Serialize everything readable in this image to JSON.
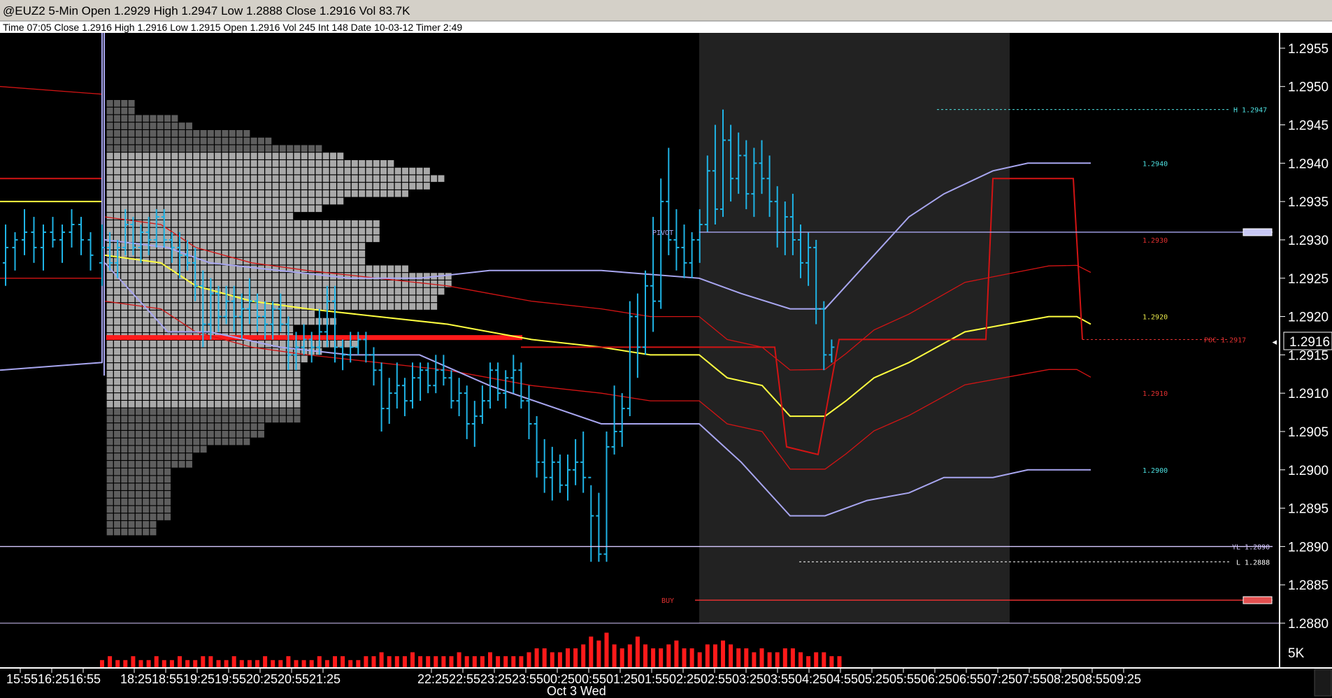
{
  "header": {
    "title": "@EUZ2 5-Min Open 1.2929 High 1.2947 Low 1.2888 Close 1.2916 Vol 83.7K",
    "info": "Time 07:05  Close 1.2916  High 1.2916  Low 1.2915  Open 1.2916  Vol 245  Int 148  Date 10-03-12  Timer 2:49"
  },
  "colors": {
    "background": "#000000",
    "price_bars": "#1fb4e6",
    "vwap": "#ffff40",
    "band_red": "#d21414",
    "band_lavender": "#a8a6f0",
    "profile_light": "#a9a9a9",
    "profile_dark": "#5e5e5e",
    "poc": "#ff1a1a",
    "session_shade": "#222222",
    "volume": "#ff1a1a"
  },
  "chart_data": {
    "type": "candlestick",
    "symbol": "@EUZ2",
    "interval": "5-Min",
    "ylim": [
      1.288,
      1.2957
    ],
    "y_ticks": [
      "1.2955",
      "1.2950",
      "1.2945",
      "1.2940",
      "1.2935",
      "1.2930",
      "1.2925",
      "1.2920",
      "1.2915",
      "1.2910",
      "1.2905",
      "1.2900",
      "1.2895",
      "1.2890",
      "1.2885",
      "1.2880"
    ],
    "last_price": "1.2916",
    "x_ticks": [
      "15:55",
      "16:25",
      "16:55",
      "18:25",
      "18:55",
      "19:25",
      "19:55",
      "20:25",
      "20:55",
      "21:25",
      "22:25",
      "22:55",
      "23:25",
      "23:55",
      "00:25",
      "00:55",
      "01:25",
      "01:55",
      "02:25",
      "02:55",
      "03:25",
      "03:55",
      "04:25",
      "04:55",
      "05:25",
      "05:55",
      "06:25",
      "06:55",
      "07:25",
      "07:55",
      "08:25",
      "08:55",
      "09:25"
    ],
    "date_label": "Oct 3 Wed",
    "volume_axis_label": "5K",
    "levels": [
      {
        "label": "H 1.2947",
        "value": 1.2947,
        "color": "#4de0e0",
        "style": "dashed"
      },
      {
        "label": "1.2940",
        "value": 1.294,
        "color": "#4de0e0",
        "style": "none"
      },
      {
        "label": "PIVOT",
        "value": 1.2931,
        "color": "#a8a6f0",
        "style": "solid"
      },
      {
        "label": "1.2930",
        "value": 1.293,
        "color": "#e23030",
        "style": "none"
      },
      {
        "label": "1.2920",
        "value": 1.292,
        "color": "#e8e84a",
        "style": "none"
      },
      {
        "label": "POC 1.2917",
        "value": 1.2917,
        "color": "#e23030",
        "style": "dashed"
      },
      {
        "label": "1.2910",
        "value": 1.291,
        "color": "#e23030",
        "style": "none"
      },
      {
        "label": "1.2900",
        "value": 1.29,
        "color": "#4de0e0",
        "style": "none"
      },
      {
        "label": "YL 1.2890",
        "value": 1.289,
        "color": "#d6c8ff",
        "style": "solid"
      },
      {
        "label": "L 1.2888",
        "value": 1.2888,
        "color": "#ffffff",
        "style": "dashed"
      },
      {
        "label": "BUY",
        "value": 1.2883,
        "color": "#e23030",
        "style": "solid"
      }
    ],
    "bars": [
      [
        1.2927,
        1.2932,
        1.2924,
        1.2929
      ],
      [
        1.2929,
        1.2931,
        1.2926,
        1.2927
      ],
      [
        1.2927,
        1.293,
        1.2925,
        1.2929
      ],
      [
        1.2929,
        1.2934,
        1.2928,
        1.2932
      ],
      [
        1.2932,
        1.2933,
        1.2928,
        1.2929
      ],
      [
        1.2929,
        1.2932,
        1.2927,
        1.2931
      ],
      [
        1.2931,
        1.2933,
        1.2928,
        1.293
      ],
      [
        1.293,
        1.2934,
        1.2929,
        1.2933
      ],
      [
        1.2933,
        1.2934,
        1.2929,
        1.293
      ],
      [
        1.293,
        1.2931,
        1.2927,
        1.2929
      ],
      [
        1.2929,
        1.2931,
        1.2925,
        1.2928
      ],
      [
        1.2928,
        1.293,
        1.2926,
        1.2927
      ],
      [
        1.2927,
        1.2929,
        1.2922,
        1.2924
      ],
      [
        1.2924,
        1.2926,
        1.2916,
        1.2919
      ],
      [
        1.2919,
        1.2925,
        1.2917,
        1.2923
      ],
      [
        1.2923,
        1.2924,
        1.2918,
        1.292
      ],
      [
        1.292,
        1.2924,
        1.2919,
        1.2922
      ],
      [
        1.2922,
        1.2924,
        1.2918,
        1.292
      ],
      [
        1.292,
        1.2923,
        1.2917,
        1.2921
      ],
      [
        1.2921,
        1.2925,
        1.2919,
        1.2922
      ],
      [
        1.2922,
        1.2923,
        1.2918,
        1.292
      ],
      [
        1.292,
        1.2922,
        1.2917,
        1.2919
      ],
      [
        1.2919,
        1.2922,
        1.2917,
        1.2921
      ],
      [
        1.2921,
        1.2923,
        1.2918,
        1.2919
      ],
      [
        1.2919,
        1.292,
        1.2913,
        1.2915
      ],
      [
        1.2915,
        1.2918,
        1.2913,
        1.2916
      ],
      [
        1.2916,
        1.2919,
        1.2915,
        1.2917
      ],
      [
        1.2917,
        1.2918,
        1.2914,
        1.2916
      ],
      [
        1.2916,
        1.2921,
        1.2915,
        1.2918
      ],
      [
        1.2918,
        1.2924,
        1.2916,
        1.2922
      ],
      [
        1.2922,
        1.2924,
        1.2914,
        1.2916
      ],
      [
        1.2916,
        1.2917,
        1.2913,
        1.2915
      ],
      [
        1.2915,
        1.2918,
        1.2914,
        1.2916
      ],
      [
        1.2916,
        1.2918,
        1.2915,
        1.2917
      ],
      [
        1.2917,
        1.2918,
        1.2914,
        1.2915
      ],
      [
        1.2915,
        1.2916,
        1.2911,
        1.2913
      ],
      [
        1.2913,
        1.2914,
        1.2905,
        1.2908
      ],
      [
        1.2908,
        1.2912,
        1.2906,
        1.291
      ],
      [
        1.291,
        1.2914,
        1.2908,
        1.2911
      ],
      [
        1.2911,
        1.2912,
        1.2907,
        1.2909
      ],
      [
        1.2909,
        1.2914,
        1.2908,
        1.2912
      ],
      [
        1.2912,
        1.2914,
        1.2909,
        1.2913
      ],
      [
        1.2913,
        1.2914,
        1.291,
        1.2911
      ],
      [
        1.2911,
        1.2915,
        1.291,
        1.2913
      ],
      [
        1.2913,
        1.2915,
        1.2911,
        1.2912
      ],
      [
        1.2912,
        1.2913,
        1.2908,
        1.2909
      ],
      [
        1.2909,
        1.2912,
        1.2907,
        1.291
      ],
      [
        1.291,
        1.2911,
        1.2904,
        1.2906
      ],
      [
        1.2906,
        1.2909,
        1.2903,
        1.2907
      ],
      [
        1.2907,
        1.2911,
        1.2906,
        1.2909
      ],
      [
        1.2909,
        1.2914,
        1.2908,
        1.2913
      ],
      [
        1.2913,
        1.2914,
        1.2909,
        1.291
      ],
      [
        1.291,
        1.2913,
        1.2908,
        1.2912
      ],
      [
        1.2912,
        1.2915,
        1.291,
        1.2913
      ],
      [
        1.2913,
        1.2914,
        1.2908,
        1.2909
      ],
      [
        1.2909,
        1.2911,
        1.2904,
        1.2906
      ],
      [
        1.2906,
        1.2907,
        1.2899,
        1.2901
      ],
      [
        1.2901,
        1.2904,
        1.2897,
        1.2899
      ],
      [
        1.2899,
        1.2903,
        1.2896,
        1.2901
      ],
      [
        1.2901,
        1.2902,
        1.2897,
        1.2898
      ],
      [
        1.2898,
        1.2902,
        1.2896,
        1.29
      ],
      [
        1.29,
        1.2904,
        1.2898,
        1.2901
      ],
      [
        1.2901,
        1.2905,
        1.2897,
        1.2899
      ],
      [
        1.2899,
        1.2898,
        1.2888,
        1.2894
      ],
      [
        1.2894,
        1.2897,
        1.2888,
        1.2889
      ],
      [
        1.2889,
        1.2905,
        1.2888,
        1.2903
      ],
      [
        1.2903,
        1.2911,
        1.2902,
        1.2905
      ],
      [
        1.2905,
        1.291,
        1.2903,
        1.2908
      ],
      [
        1.2908,
        1.2922,
        1.2907,
        1.292
      ],
      [
        1.292,
        1.2923,
        1.2912,
        1.2916
      ],
      [
        1.2916,
        1.2926,
        1.2915,
        1.2924
      ],
      [
        1.2924,
        1.2933,
        1.2918,
        1.2922
      ],
      [
        1.2922,
        1.2938,
        1.2921,
        1.2935
      ],
      [
        1.2935,
        1.2942,
        1.2928,
        1.293
      ],
      [
        1.293,
        1.2934,
        1.2926,
        1.2929
      ],
      [
        1.2929,
        1.2932,
        1.2925,
        1.2927
      ],
      [
        1.2927,
        1.2931,
        1.2925,
        1.293
      ],
      [
        1.293,
        1.2934,
        1.2927,
        1.2932
      ],
      [
        1.2932,
        1.2941,
        1.2931,
        1.2939
      ],
      [
        1.2939,
        1.2945,
        1.2932,
        1.2934
      ],
      [
        1.2934,
        1.2947,
        1.2933,
        1.2943
      ],
      [
        1.2943,
        1.2945,
        1.2935,
        1.2938
      ],
      [
        1.2938,
        1.2944,
        1.2936,
        1.2941
      ],
      [
        1.2941,
        1.2943,
        1.2934,
        1.2936
      ],
      [
        1.2936,
        1.2942,
        1.2933,
        1.294
      ],
      [
        1.294,
        1.2943,
        1.2936,
        1.2938
      ],
      [
        1.2938,
        1.2941,
        1.2933,
        1.2935
      ],
      [
        1.2935,
        1.2937,
        1.2929,
        1.2931
      ],
      [
        1.2931,
        1.2935,
        1.2928,
        1.2933
      ],
      [
        1.2933,
        1.2936,
        1.2928,
        1.293
      ],
      [
        1.293,
        1.2932,
        1.2925,
        1.2927
      ],
      [
        1.2927,
        1.2931,
        1.2924,
        1.2929
      ],
      [
        1.2929,
        1.293,
        1.2919,
        1.2921
      ],
      [
        1.2921,
        1.2922,
        1.2913,
        1.2915
      ],
      [
        1.2915,
        1.2917,
        1.2914,
        1.2916
      ]
    ],
    "volume": [
      2,
      3,
      2,
      2,
      3,
      2,
      2,
      3,
      2,
      2,
      3,
      2,
      2,
      3,
      3,
      2,
      2,
      3,
      2,
      2,
      2,
      3,
      2,
      2,
      3,
      2,
      2,
      2,
      3,
      2,
      3,
      3,
      2,
      2,
      3,
      3,
      4,
      3,
      3,
      3,
      4,
      3,
      3,
      3,
      3,
      3,
      4,
      3,
      3,
      3,
      4,
      3,
      3,
      3,
      3,
      4,
      5,
      5,
      4,
      4,
      5,
      5,
      6,
      8,
      7,
      9,
      6,
      5,
      6,
      8,
      6,
      5,
      5,
      6,
      7,
      5,
      5,
      4,
      6,
      6,
      7,
      6,
      5,
      5,
      4,
      5,
      4,
      4,
      5,
      5,
      4,
      3,
      4,
      4,
      3,
      3
    ]
  }
}
